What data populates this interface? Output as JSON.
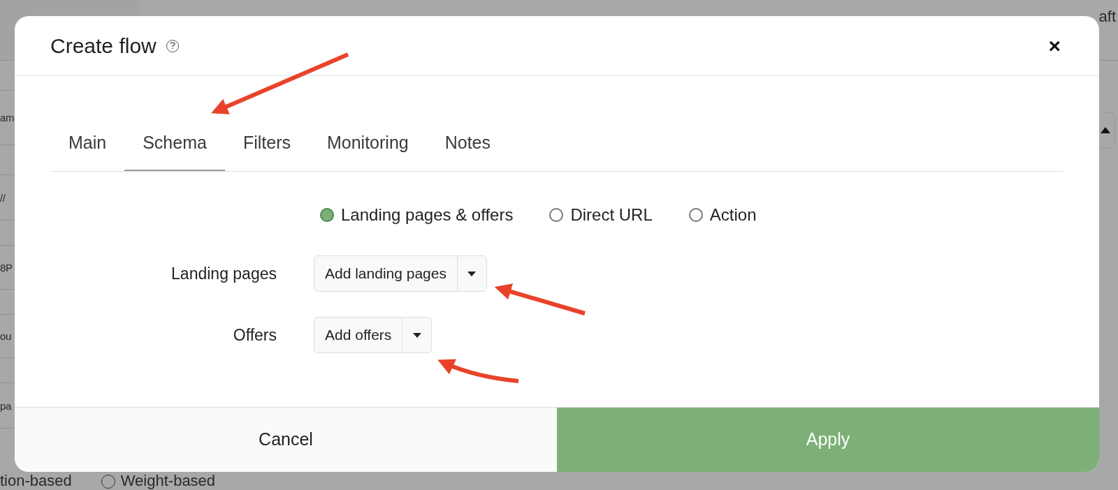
{
  "background": {
    "left_fragments": [
      "am",
      "//",
      "8P",
      "ou",
      "pa"
    ],
    "bottom_fragment": "tion-based",
    "weight_option": {
      "label": "Weight-based",
      "selected": false
    },
    "right_fragment": "aft"
  },
  "dialog": {
    "title": "Create flow",
    "close": "×",
    "tabs": [
      {
        "label": "Main",
        "selected": false
      },
      {
        "label": "Schema",
        "selected": true
      },
      {
        "label": "Filters",
        "selected": false
      },
      {
        "label": "Monitoring",
        "selected": false
      },
      {
        "label": "Notes",
        "selected": false
      }
    ],
    "schema_options": [
      {
        "label": "Landing pages & offers",
        "selected": true
      },
      {
        "label": "Direct URL",
        "selected": false
      },
      {
        "label": "Action",
        "selected": false
      }
    ],
    "fields": [
      {
        "label": "Landing pages",
        "button": "Add landing pages"
      },
      {
        "label": "Offers",
        "button": "Add offers"
      }
    ],
    "buttons": [
      {
        "label": "Cancel",
        "kind": "secondary"
      },
      {
        "label": "Apply",
        "kind": "primary"
      }
    ]
  }
}
